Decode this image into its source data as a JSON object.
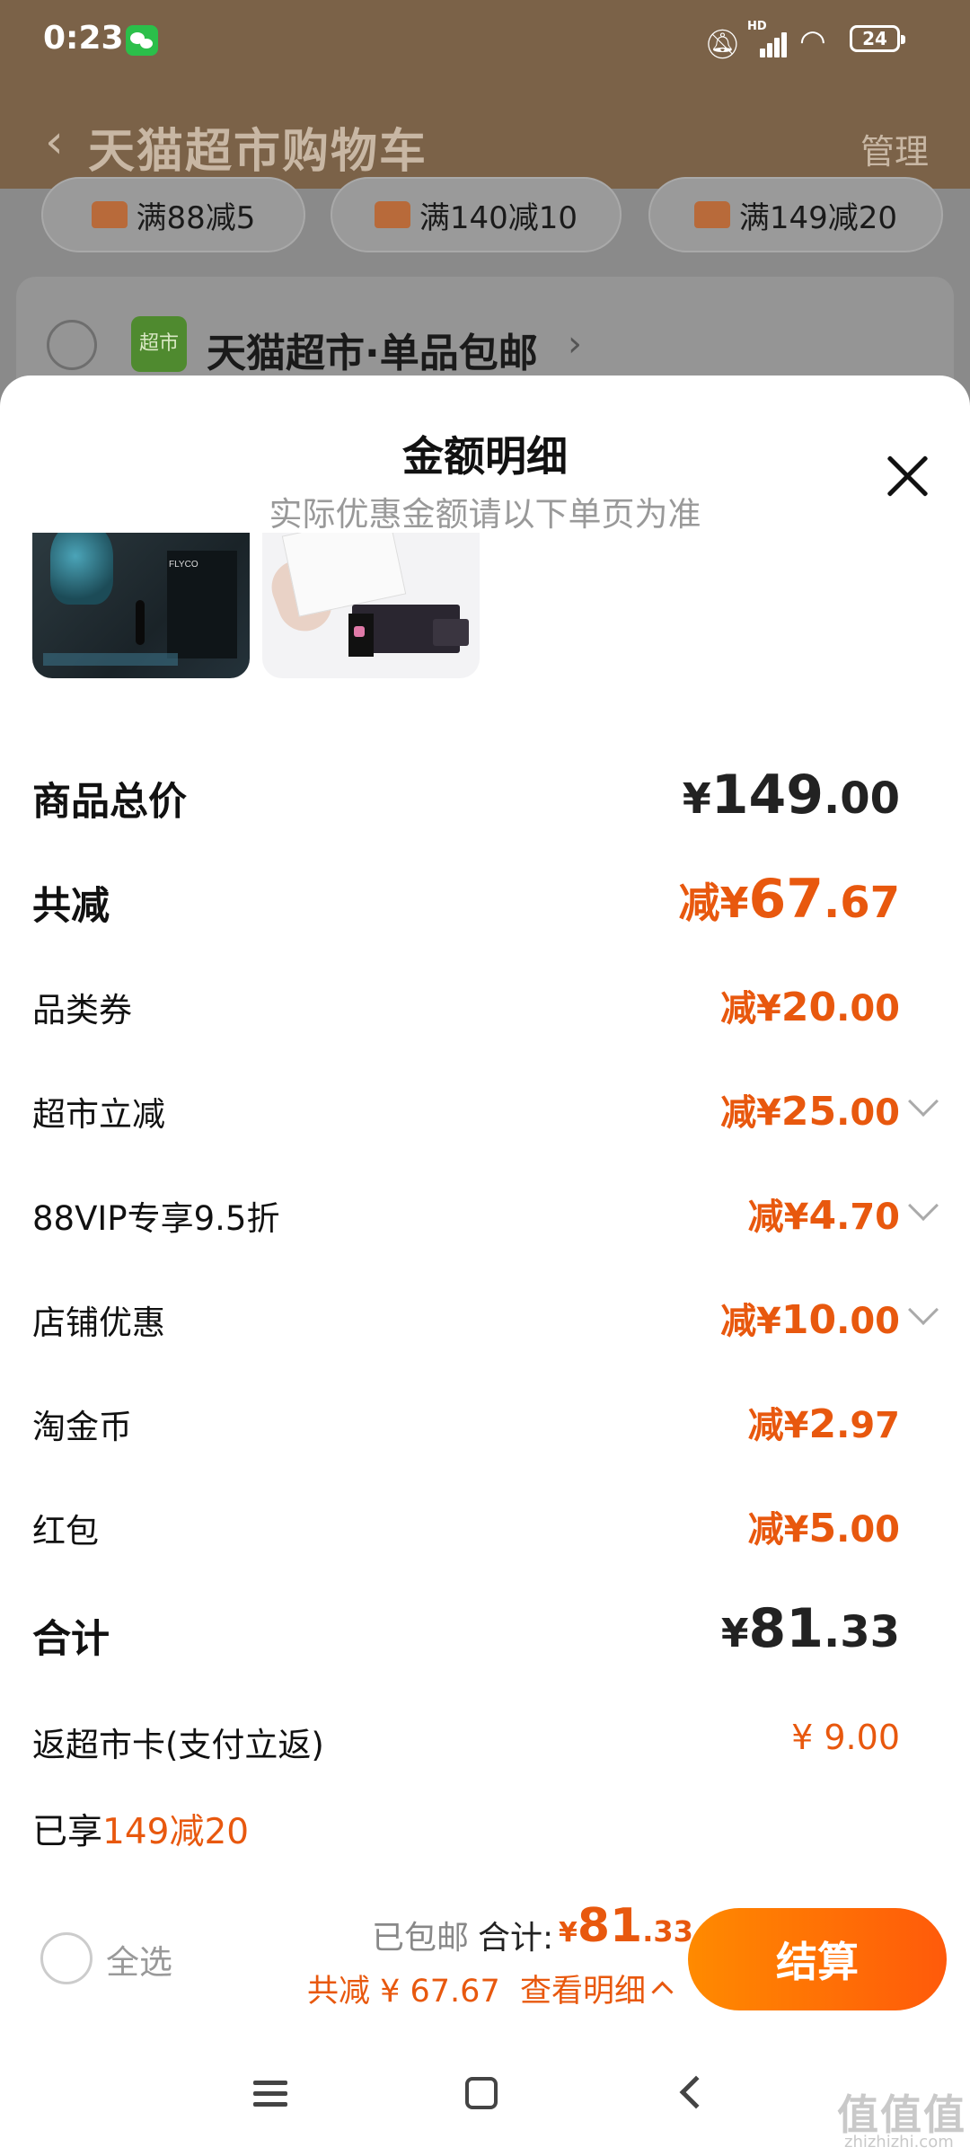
{
  "status_bar": {
    "time": "0:23",
    "battery": "24",
    "signal_badge": "HD"
  },
  "background": {
    "nav": {
      "title": "天猫超市购物车",
      "manage": "管理"
    },
    "promo_chips": [
      "满88减5",
      "满140减10",
      "满149减20"
    ],
    "store": {
      "logo_text": "超市",
      "name": "天猫超市·单品包邮"
    }
  },
  "sheet": {
    "title": "金额明细",
    "subtitle": "实际优惠金额请以下单页为准",
    "rows": [
      {
        "label": "商品总价",
        "currency": "¥",
        "integer": "149",
        "decimal": ".00"
      },
      {
        "label": "共减",
        "prefix": "减¥",
        "integer": "67",
        "decimal": ".67"
      },
      {
        "label": "品类券",
        "prefix": "减¥",
        "integer": "20",
        "decimal": ".00"
      },
      {
        "label": "超市立减",
        "prefix": "减¥",
        "integer": "25",
        "decimal": ".00"
      },
      {
        "label": "88VIP专享9.5折",
        "prefix": "减¥",
        "integer": "4",
        "decimal": ".70"
      },
      {
        "label": "店铺优惠",
        "prefix": "减¥",
        "integer": "10",
        "decimal": ".00"
      },
      {
        "label": "淘金币",
        "prefix": "减¥",
        "integer": "2",
        "decimal": ".97"
      },
      {
        "label": "红包",
        "prefix": "减¥",
        "integer": "5",
        "decimal": ".00"
      },
      {
        "label": "合计",
        "currency": "¥",
        "integer": "81",
        "decimal": ".33"
      },
      {
        "label": "返超市卡(支付立返)",
        "value": "¥ 9.00"
      }
    ],
    "enjoy": {
      "prefix": "已享",
      "highlight": "149减20"
    },
    "thumbs": {
      "brand_text": "FLYCO"
    }
  },
  "bottom_bar": {
    "select_all": "全选",
    "shipping": "已包邮",
    "sum_label": "合计:",
    "sum_currency": "¥",
    "sum_integer": "81",
    "sum_decimal": ".33",
    "discount": "共减 ¥ 67.67",
    "view_details": "查看明细",
    "checkout": "结算"
  },
  "watermark": {
    "text": "值值值",
    "sub": "zhizhizhi.com"
  },
  "colors": {
    "accent": "#e8580e",
    "checkout_start": "#ff8a00",
    "checkout_end": "#ff5a0a",
    "header_bg": "#7b6248"
  }
}
